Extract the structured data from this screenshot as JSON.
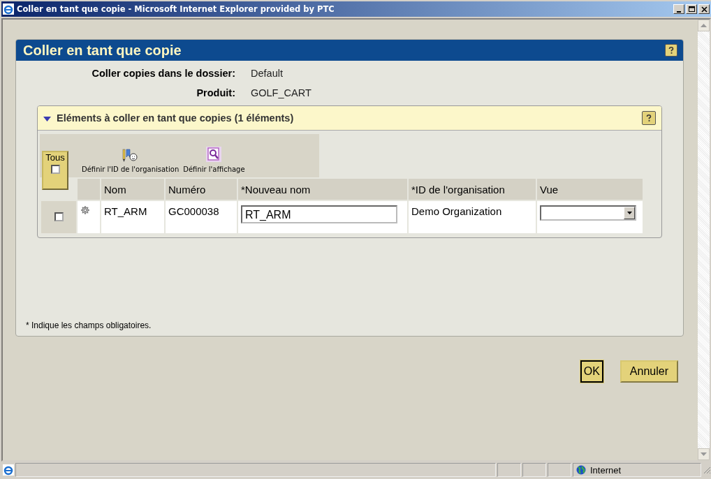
{
  "window": {
    "title": "Coller en tant que copie - Microsoft Internet Explorer provided by PTC"
  },
  "page": {
    "title": "Coller en tant que copie"
  },
  "fields": [
    {
      "label": "Coller copies dans le dossier:",
      "value": "Default"
    },
    {
      "label": "Produit:",
      "value": "GOLF_CART"
    }
  ],
  "section": {
    "title": "Eléments à coller en tant que copies (1 éléments)",
    "expanded": true
  },
  "toolbar": [
    {
      "label": "Définir l'ID de l'organisation",
      "kind": "org"
    },
    {
      "label": "Définir l'affichage",
      "kind": "view"
    }
  ],
  "select_all": {
    "label": "Tous",
    "checked": false
  },
  "table": {
    "columns": [
      "Nom",
      "Numéro",
      "*Nouveau nom",
      "*ID de l'organisation",
      "Vue"
    ],
    "rows": [
      {
        "checked": false,
        "nom": "RT_ARM",
        "numero": "GC000038",
        "nouveau_nom": "RT_ARM",
        "organisation": "Demo Organization"
      }
    ]
  },
  "footnote": "* Indique les champs obligatoires.",
  "buttons": [
    {
      "label": "OK",
      "default": true
    },
    {
      "label": "Annuler",
      "default": false
    }
  ],
  "status_bar": {
    "zone": "Internet"
  }
}
